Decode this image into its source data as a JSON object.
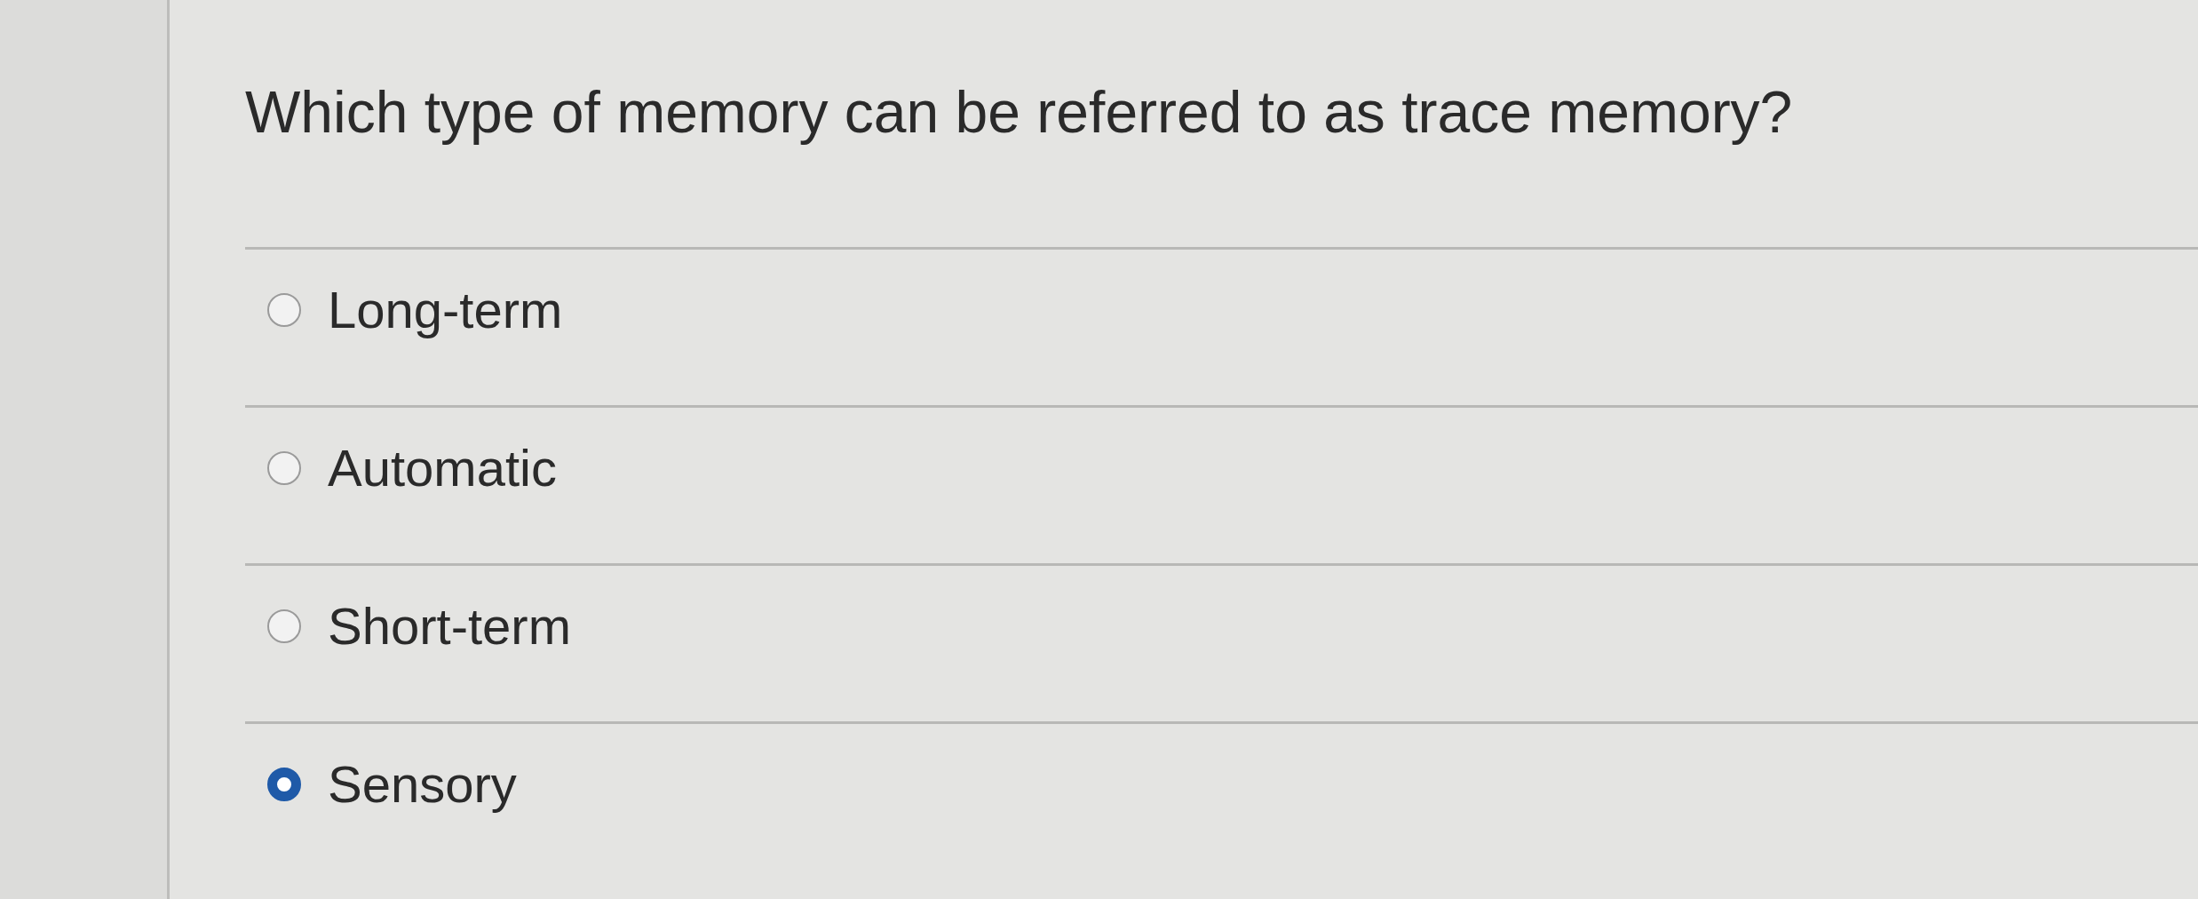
{
  "question": "Which type of memory can be referred to as trace memory?",
  "options": [
    {
      "label": "Long-term",
      "selected": false
    },
    {
      "label": "Automatic",
      "selected": false
    },
    {
      "label": "Short-term",
      "selected": false
    },
    {
      "label": "Sensory",
      "selected": true
    }
  ]
}
